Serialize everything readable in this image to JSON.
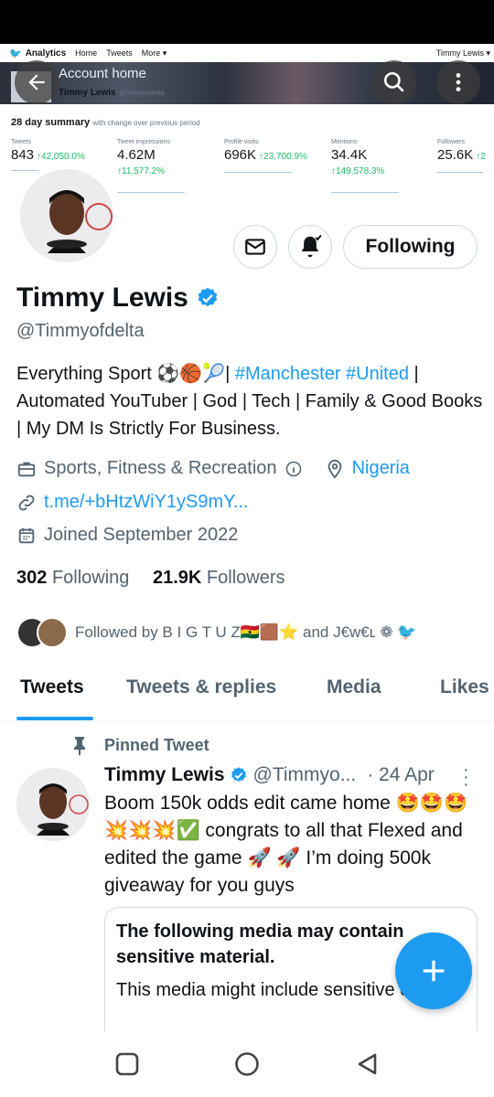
{
  "banner": {
    "analytics_label": "Analytics",
    "nav": [
      "Home",
      "Tweets",
      "More ▾"
    ],
    "account_right": "Timmy Lewis ▾",
    "account_home": "Account home",
    "banner_name": "Timmy Lewis",
    "banner_handle": "@Timmyofdelta",
    "summary_title": "28 day summary",
    "summary_sub": "with change over previous period",
    "stats": [
      {
        "label": "Tweets",
        "value": "843",
        "change": "↑42,050.0%"
      },
      {
        "label": "Tweet impressions",
        "value": "4.62M",
        "change": "↑11,577.2%"
      },
      {
        "label": "Profile visits",
        "value": "696K",
        "change": "↑23,700.9%"
      },
      {
        "label": "Mentions",
        "value": "34.4K",
        "change": "↑149,578.3%"
      },
      {
        "label": "Followers",
        "value": "25.6K",
        "change": "↑2"
      }
    ]
  },
  "actions": {
    "follow_label": "Following"
  },
  "profile": {
    "name": "Timmy Lewis",
    "handle": "@Timmyofdelta",
    "bio_start": "Everything Sport ⚽🏀🎾| ",
    "bio_tags": "#Manchester #United",
    "bio_end": " | Automated YouTuber | God | Tech | Family & Good Books | My DM Is Strictly For Business.",
    "category": "Sports, Fitness & Recreation",
    "location": "Nigeria",
    "url": "t.me/+bHtzWiY1yS9mY...",
    "joined": "Joined September 2022",
    "following_count": "302",
    "following_label": "Following",
    "followers_count": "21.9K",
    "followers_label": "Followers",
    "followed_by": "Followed by B I G T U Z🇬🇭🟫⭐ and J€w€ʟ ❁ 🐦"
  },
  "tabs": [
    "Tweets",
    "Tweets & replies",
    "Media",
    "Likes"
  ],
  "tweet": {
    "pinned_label": "Pinned Tweet",
    "name": "Timmy Lewis",
    "handle": "@Timmyo...",
    "date": "· 24 Apr",
    "text": "Boom 150k odds edit came home 🤩🤩🤩💥💥💥✅ congrats to all that Flexed and edited the game 🚀 🚀  I’m doing 500k giveaway for you guys",
    "card_title": "The following media may contain sensitive material.",
    "card_sub": "This media might include sensitive content"
  },
  "colors": {
    "accent": "#1d9bf0",
    "text": "#0f1419",
    "muted": "#536471"
  }
}
